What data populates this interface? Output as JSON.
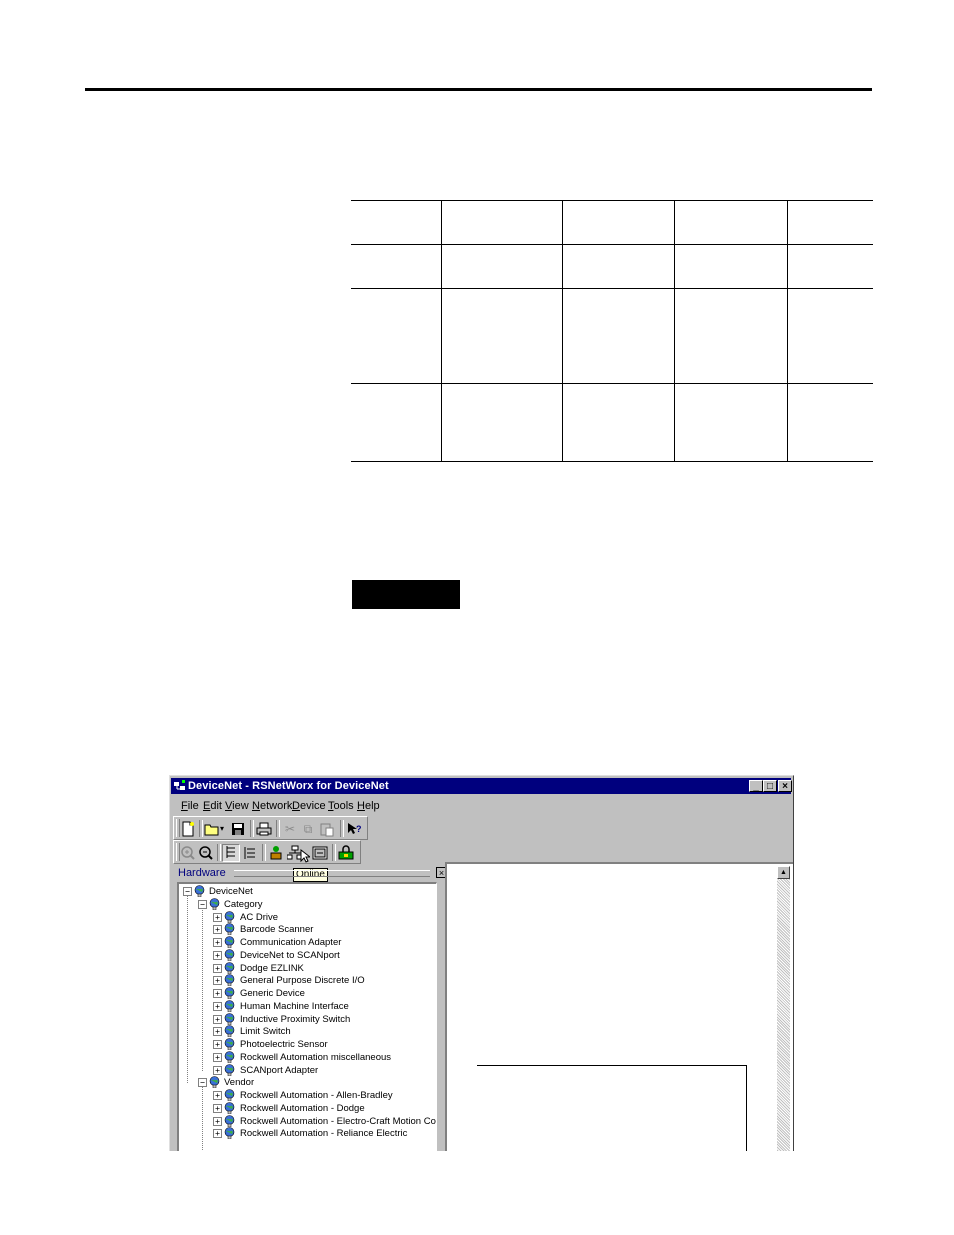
{
  "window": {
    "title": "DeviceNet - RSNetWorx for DeviceNet",
    "title_buttons": [
      "_",
      "□",
      "×"
    ]
  },
  "menu": [
    {
      "u": "F",
      "rest": "ile"
    },
    {
      "u": "E",
      "rest": "dit"
    },
    {
      "u": "V",
      "rest": "iew"
    },
    {
      "u": "N",
      "rest": "etwork"
    },
    {
      "u": "D",
      "rest": "evice"
    },
    {
      "u": "T",
      "rest": "ools"
    },
    {
      "u": "H",
      "rest": "elp"
    }
  ],
  "tooltip": "Online",
  "hardware_panel": {
    "title": "Hardware",
    "close": "×"
  },
  "tree": {
    "root": "DeviceNet",
    "category": "Category",
    "category_items": [
      "AC Drive",
      "Barcode Scanner",
      "Communication Adapter",
      "DeviceNet to SCANport",
      "Dodge EZLINK",
      "General Purpose Discrete I/O",
      "Generic Device",
      "Human Machine Interface",
      "Inductive Proximity Switch",
      "Limit Switch",
      "Photoelectric Sensor",
      "Rockwell Automation miscellaneous",
      "SCANport Adapter"
    ],
    "vendor": "Vendor",
    "vendor_items": [
      "Rockwell Automation - Allen-Bradley",
      "Rockwell Automation - Dodge",
      "Rockwell Automation - Electro-Craft Motion Control",
      "Rockwell Automation - Reliance Electric"
    ]
  },
  "icons": {
    "new": "new-file-icon",
    "open": "open-folder-icon",
    "save": "save-icon",
    "print": "print-icon",
    "cut": "cut-icon",
    "copy": "copy-icon",
    "paste": "paste-icon",
    "help": "whats-this-help-icon",
    "zoom_in": "zoom-in-icon",
    "zoom_out": "zoom-out-icon",
    "online": "online-icon"
  },
  "colors": {
    "titlebar": "#00007e",
    "chrome": "#c0c0c0",
    "tooltip_bg": "#ffffe1"
  }
}
